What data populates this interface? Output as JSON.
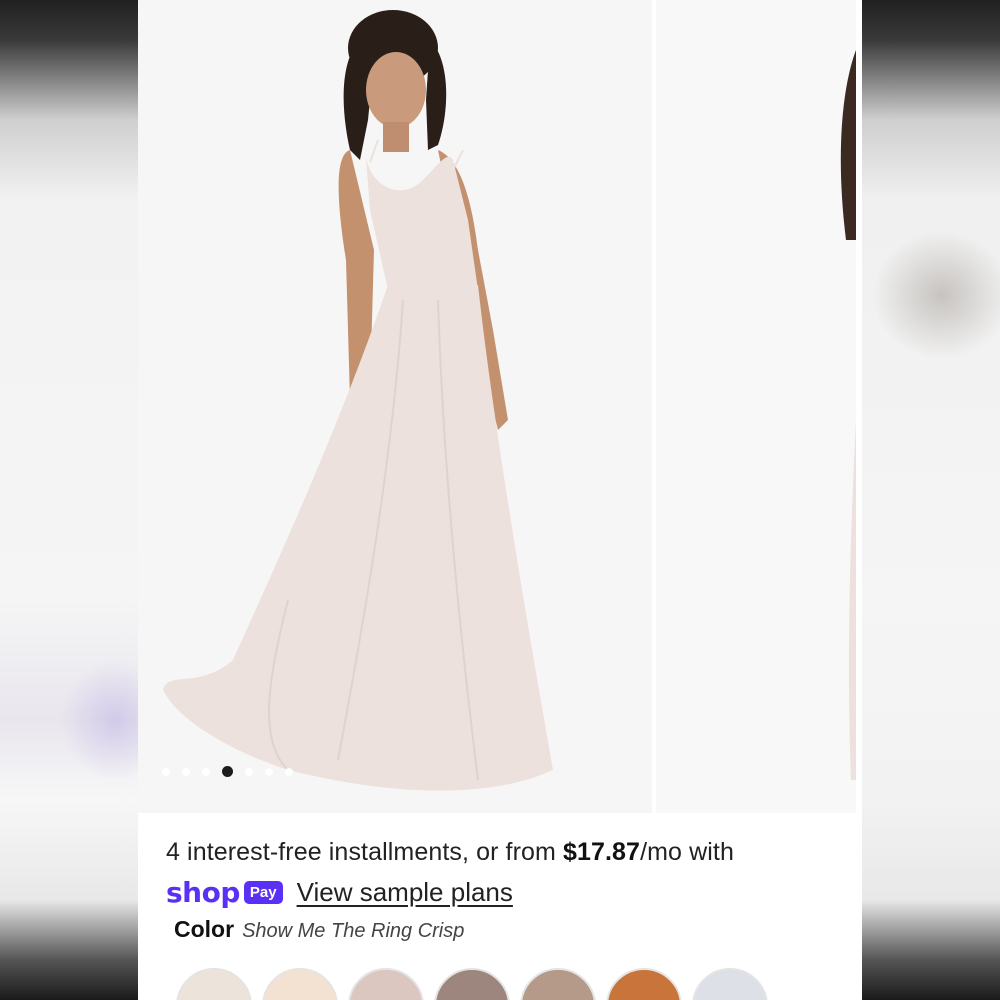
{
  "installments": {
    "prefix": "4 interest-free installments, or from ",
    "price": "$17.87",
    "suffix": "/mo with"
  },
  "shop_pay": {
    "shop_word": "shop",
    "pay_word": "Pay",
    "sample_link": "View sample plans"
  },
  "color": {
    "label": "Color",
    "value": "Show Me The Ring Crisp"
  },
  "gallery": {
    "dots_total": 7,
    "active_index": 3
  },
  "swatches": [
    {
      "color": "#ece3da"
    },
    {
      "color": "#f3e1d2"
    },
    {
      "color": "#dcc6c0"
    },
    {
      "color": "#9c867d"
    },
    {
      "color": "#b59a8a"
    },
    {
      "color": "#c8743a"
    },
    {
      "color": "#dde0e6"
    }
  ],
  "colors": {
    "shop_pay_purple": "#5a31f4",
    "dress": "#ece1dc"
  }
}
